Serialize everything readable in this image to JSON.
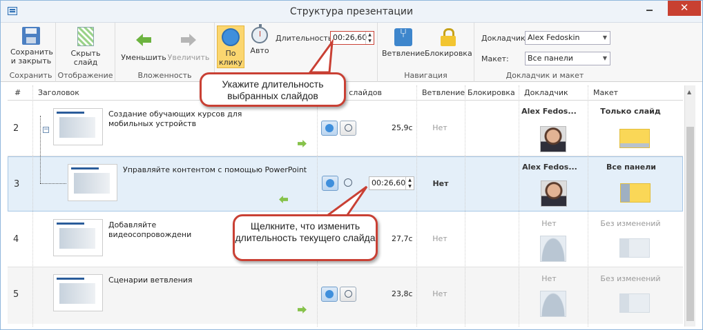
{
  "window": {
    "title": "Структура презентации",
    "minimize": "—",
    "maximize": "□",
    "close": "✕"
  },
  "ribbon": {
    "save": {
      "label": "Сохранить и закрыть",
      "group": "Сохранить"
    },
    "display": {
      "label": "Скрыть слайд",
      "group": "Отображение"
    },
    "nesting": {
      "decrease": "Уменьшить",
      "increase": "Увеличить",
      "group": "Вложенность"
    },
    "timing": {
      "on_click": "По клику",
      "auto": "Авто",
      "duration_label": "Длительность:",
      "duration_value": "00:26,60"
    },
    "navigation": {
      "branching": "Ветвление",
      "lock": "Блокировка",
      "group": "Навигация"
    },
    "presenter": {
      "presenter_label": "Докладчик:",
      "presenter_value": "Alex Fedoskin",
      "layout_label": "Макет:",
      "layout_value": "Все панели",
      "group": "Докладчик и макет"
    }
  },
  "columns": [
    "#",
    "Заголовок",
    "а слайдов",
    "Ветвление",
    "Блокировка",
    "Докладчик",
    "Макет"
  ],
  "rows": [
    {
      "num": "2",
      "title": "Создание обучающих курсов для мобильных устройств",
      "duration": "25,9с",
      "branch": "Нет",
      "presenter": "Alex Fedos...",
      "layout": "Только слайд"
    },
    {
      "num": "3",
      "title": "Управляйте контентом с помощью PowerPoint",
      "duration": "00:26,60",
      "branch": "Нет",
      "presenter": "Alex Fedos...",
      "layout": "Все панели"
    },
    {
      "num": "4",
      "title": "Добавляйте видеосопровождени",
      "duration": "27,7с",
      "branch": "Нет",
      "presenter": "Нет",
      "layout": "Без изменений"
    },
    {
      "num": "5",
      "title": "Сценарии ветвления",
      "duration": "23,8с",
      "branch": "Нет",
      "presenter": "Нет",
      "layout": "Без изменений"
    }
  ],
  "callouts": {
    "top": "Укажите длительность выбранных слайдов",
    "bottom": "Щелкните, что изменить длительность текущего слайда"
  },
  "colors": {
    "accent_red": "#c94034",
    "selection": "#e4eff9",
    "active_button": "#fbd66f"
  }
}
